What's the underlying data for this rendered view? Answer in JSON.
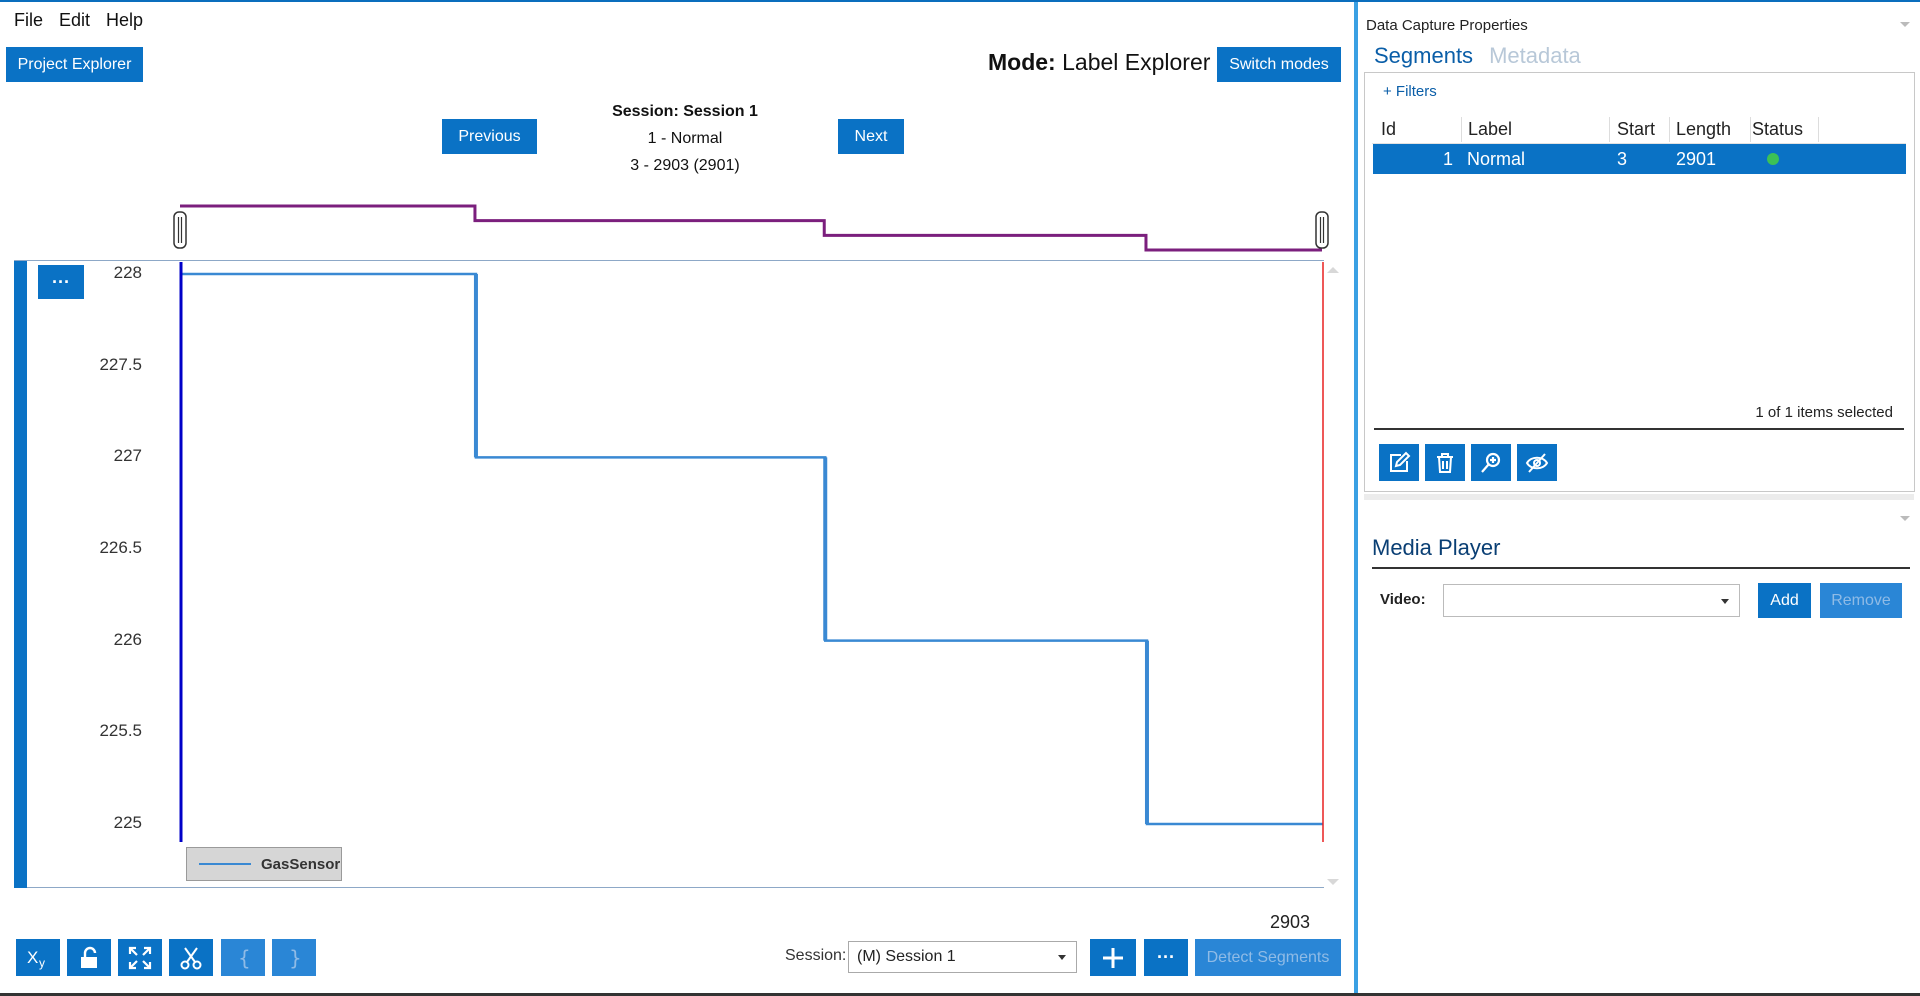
{
  "menu": [
    "File",
    "Edit",
    "Help"
  ],
  "header": {
    "project_explorer_label": "Project Explorer",
    "mode_prefix": "Mode:",
    "mode_value": "Label Explorer",
    "switch_modes_label": "Switch modes"
  },
  "navigation": {
    "previous_label": "Previous",
    "next_label": "Next",
    "session_title": "Session: Session 1",
    "segment_label": "1 - Normal",
    "segment_range": "3 - 2903 (2901)"
  },
  "chart": {
    "ellipsis_label": "···",
    "end_value": "2903",
    "colors": {
      "series": "#3a89d3",
      "overview": "#7b1f7d",
      "start_marker": "#0000c8",
      "end_marker": "#e82020"
    }
  },
  "chart_data": {
    "type": "line",
    "title": "",
    "xlabel": "",
    "ylabel": "",
    "ylim": [
      225,
      228
    ],
    "yticks": [
      "228",
      "227.5",
      "227",
      "226.5",
      "226",
      "225.5",
      "225"
    ],
    "xlim": [
      3,
      2903
    ],
    "series": [
      {
        "name": "GasSensor",
        "x": [
          3,
          752,
          752,
          1639,
          1639,
          2456,
          2456,
          2903
        ],
        "y": [
          228,
          228,
          227,
          227,
          226,
          226,
          225,
          225
        ]
      }
    ],
    "legend": "bottom-left",
    "grid": false
  },
  "toolbar": {
    "session_label": "Session:",
    "session_value": "(M) Session 1",
    "detect_segments_label": "Detect Segments",
    "more_label": "···"
  },
  "right_panel": {
    "title": "Data Capture Properties",
    "tabs": [
      {
        "label": "Segments",
        "active": true
      },
      {
        "label": "Metadata",
        "active": false
      }
    ],
    "filters_label": "+ Filters",
    "table": {
      "columns": [
        "Id",
        "Label",
        "Start",
        "Length",
        "Status"
      ],
      "rows": [
        {
          "id": "1",
          "label": "Normal",
          "start": "3",
          "length": "2901",
          "status": "ok"
        }
      ]
    },
    "items_selected": "1 of 1 items selected",
    "icons": [
      "edit-icon",
      "trash-icon",
      "zoom-icon",
      "hide-icon"
    ]
  },
  "media_player": {
    "title": "Media Player",
    "video_label": "Video:",
    "video_value": "",
    "add_label": "Add",
    "remove_label": "Remove"
  }
}
